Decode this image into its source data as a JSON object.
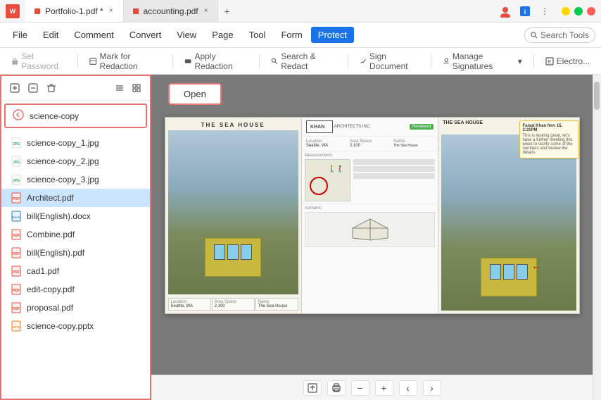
{
  "titlebar": {
    "app_logo": "W",
    "tabs": [
      {
        "label": "Portfolio-1.pdf *",
        "active": true
      },
      {
        "label": "accounting.pdf",
        "active": false
      }
    ],
    "add_tab_label": "+",
    "buttons": {
      "back": "←",
      "forward": "→",
      "minimize": "−",
      "maximize": "□",
      "close": "×"
    }
  },
  "menubar": {
    "items": [
      {
        "label": "File",
        "id": "file"
      },
      {
        "label": "Edit",
        "id": "edit"
      },
      {
        "label": "Comment",
        "id": "comment"
      },
      {
        "label": "Convert",
        "id": "convert"
      },
      {
        "label": "View",
        "id": "view"
      },
      {
        "label": "Page",
        "id": "page"
      },
      {
        "label": "Tool",
        "id": "tool"
      },
      {
        "label": "Form",
        "id": "form"
      },
      {
        "label": "Protect",
        "id": "protect",
        "active": true
      }
    ],
    "search_placeholder": "Search Tools"
  },
  "toolbar": {
    "items": [
      {
        "label": "Set Password",
        "id": "set-password",
        "disabled": true
      },
      {
        "label": "Mark for Redaction",
        "id": "mark-redaction",
        "disabled": false
      },
      {
        "label": "Apply Redaction",
        "id": "apply-redaction",
        "disabled": false
      },
      {
        "label": "Search & Redact",
        "id": "search-redact",
        "disabled": false
      },
      {
        "label": "Sign Document",
        "id": "sign-document",
        "disabled": false
      },
      {
        "label": "Manage Signatures",
        "id": "manage-signatures"
      },
      {
        "label": "Electro...",
        "id": "electro"
      }
    ]
  },
  "sidebar": {
    "folder_name": "science-copy",
    "files": [
      {
        "name": "science-copy_1.jpg",
        "type": "jpg"
      },
      {
        "name": "science-copy_2.jpg",
        "type": "jpg"
      },
      {
        "name": "science-copy_3.jpg",
        "type": "jpg"
      },
      {
        "name": "Architect.pdf",
        "type": "pdf",
        "selected": true
      },
      {
        "name": "bill(English).docx",
        "type": "docx"
      },
      {
        "name": "Combine.pdf",
        "type": "pdf"
      },
      {
        "name": "bill(English).pdf",
        "type": "pdf"
      },
      {
        "name": "cad1.pdf",
        "type": "pdf"
      },
      {
        "name": "edit-copy.pdf",
        "type": "pdf"
      },
      {
        "name": "proposal.pdf",
        "type": "pdf"
      },
      {
        "name": "science-copy.pptx",
        "type": "pptx"
      }
    ]
  },
  "content": {
    "open_button_label": "Open",
    "pdf": {
      "page1": {
        "title": "THE SEA HOUSE",
        "location": "Seattle, WA",
        "area_space": "2,100",
        "name": "The Sea House"
      },
      "page2": {
        "title": "KHAN ARCHITECTS INC.",
        "reviewed_label": "Reviewed",
        "location_label": "Location",
        "location_val": "Seattle, WA",
        "area_label": "Area Space",
        "area_val": "2,100",
        "name_label": "Name",
        "name_val": "The Sea House",
        "measurements_label": "Measurements",
        "isometric_label": "Isometric"
      },
      "page3": {
        "title": "THE SEA HOUSE",
        "comment_author": "Faisal Khan  Nov 15, 3:31PM",
        "comment_text": "This is looking great, let's have a further meeting this week to clarify some of the numbers and review the details."
      }
    }
  },
  "bottom_toolbar": {
    "export_icon": "⬆",
    "print_icon": "🖨",
    "zoom_out_icon": "−",
    "zoom_in_icon": "+",
    "prev_icon": "‹",
    "next_icon": "›"
  }
}
